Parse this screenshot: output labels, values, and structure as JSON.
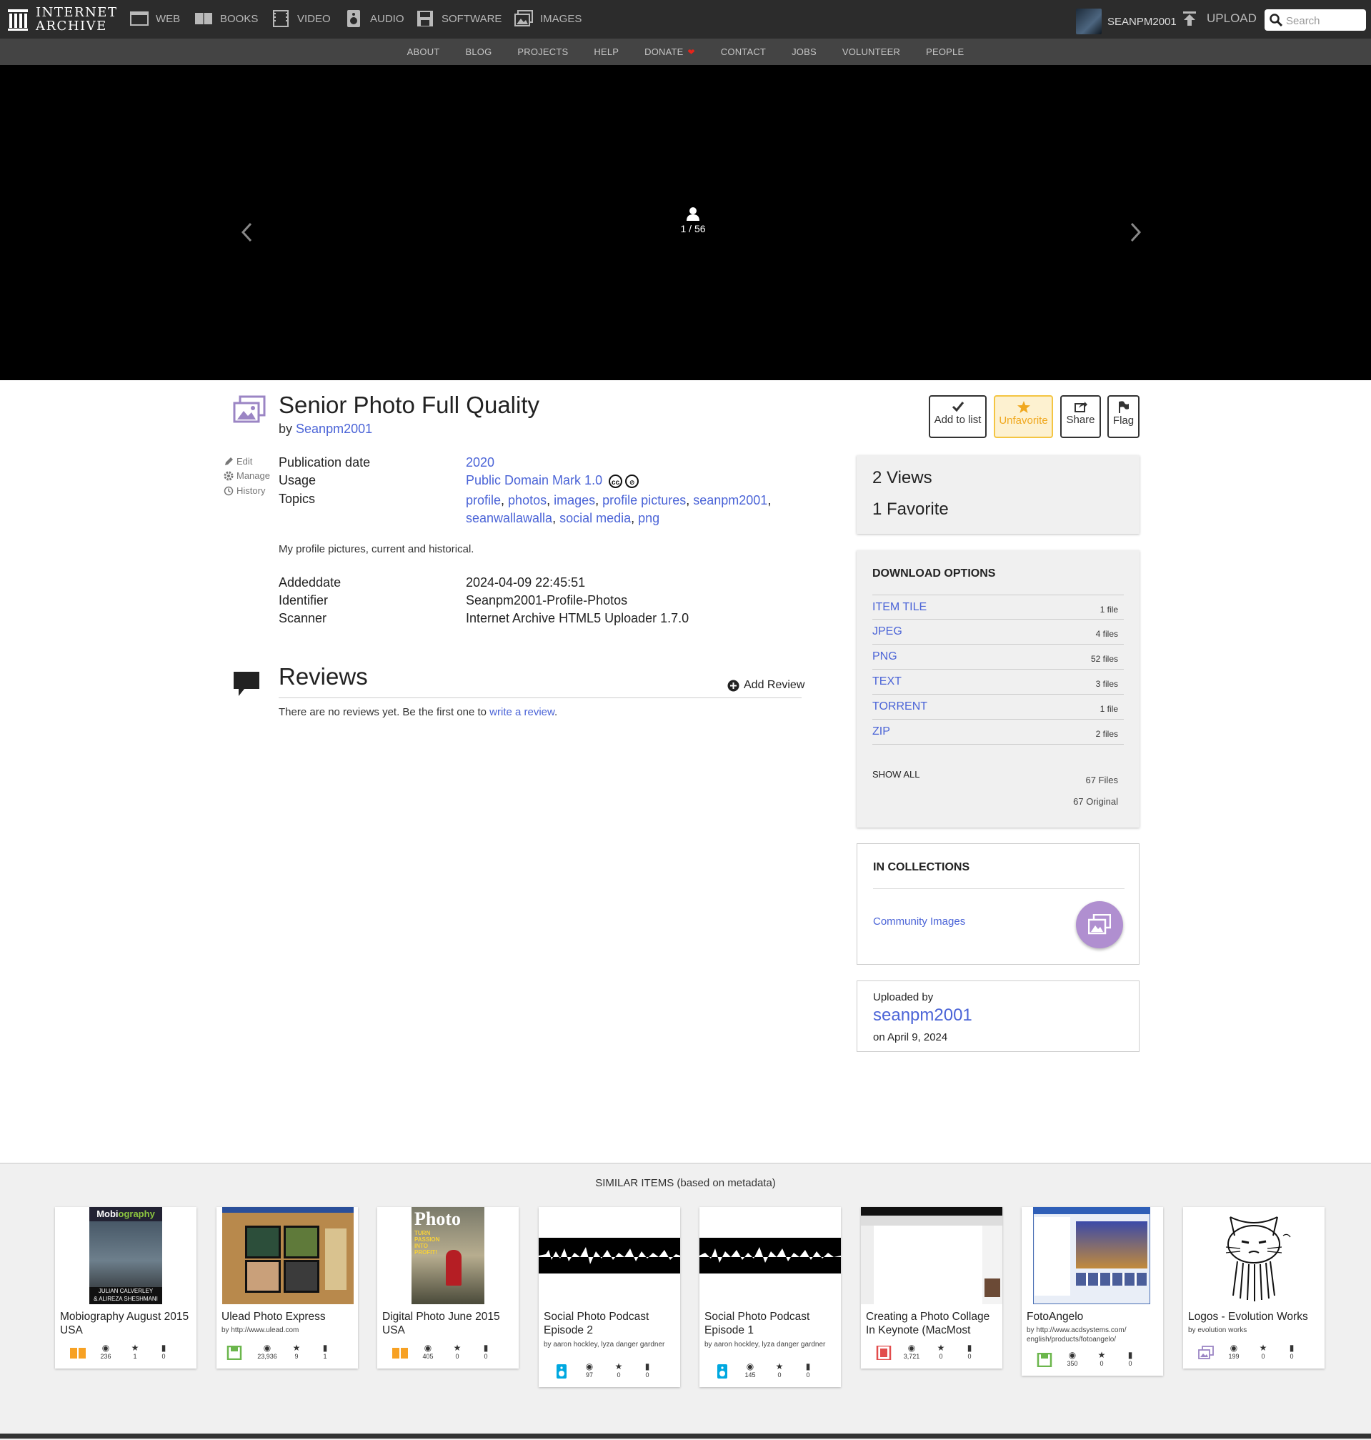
{
  "header": {
    "logo_line1": "INTERNET",
    "logo_line2": "ARCHIVE",
    "nav": [
      {
        "label": "WEB",
        "icon": "web-icon"
      },
      {
        "label": "BOOKS",
        "icon": "books-icon"
      },
      {
        "label": "VIDEO",
        "icon": "video-icon"
      },
      {
        "label": "AUDIO",
        "icon": "audio-icon"
      },
      {
        "label": "SOFTWARE",
        "icon": "software-icon"
      },
      {
        "label": "IMAGES",
        "icon": "images-icon"
      }
    ],
    "username": "SEANPM2001",
    "upload_label": "UPLOAD",
    "search_placeholder": "Search"
  },
  "subnav": [
    "ABOUT",
    "BLOG",
    "PROJECTS",
    "HELP",
    "DONATE",
    "CONTACT",
    "JOBS",
    "VOLUNTEER",
    "PEOPLE"
  ],
  "viewer": {
    "page_indicator": "1 / 56"
  },
  "item": {
    "title": "Senior Photo Full Quality",
    "by_prefix": "by",
    "creator": "Seanpm2001",
    "actions": {
      "add_to_list": "Add to list",
      "unfavorite": "Unfavorite",
      "share": "Share",
      "flag": "Flag"
    },
    "side_links": {
      "edit": "Edit",
      "manage": "Manage",
      "history": "History"
    },
    "metadata": {
      "publication_date_label": "Publication date",
      "publication_date": "2020",
      "usage_label": "Usage",
      "usage": "Public Domain Mark 1.0",
      "topics_label": "Topics",
      "topics": [
        "profile",
        "photos",
        "images",
        "profile pictures",
        "seanpm2001",
        "seanwallawalla",
        "social media",
        "png"
      ]
    },
    "description": "My profile pictures, current and historical.",
    "details": {
      "addeddate_label": "Addeddate",
      "addeddate": "2024-04-09 22:45:51",
      "identifier_label": "Identifier",
      "identifier": "Seanpm2001-Profile-Photos",
      "scanner_label": "Scanner",
      "scanner": "Internet Archive HTML5 Uploader 1.7.0"
    }
  },
  "reviews": {
    "title": "Reviews",
    "add_label": "Add Review",
    "empty_text": "There are no reviews yet. Be the first one to",
    "empty_link": "write a review"
  },
  "stats": {
    "views": "2 Views",
    "favorites": "1 Favorite"
  },
  "downloads": {
    "title": "DOWNLOAD OPTIONS",
    "rows": [
      {
        "name": "ITEM TILE",
        "count": "1 file"
      },
      {
        "name": "JPEG",
        "count": "4 files"
      },
      {
        "name": "PNG",
        "count": "52 files"
      },
      {
        "name": "TEXT",
        "count": "3 files"
      },
      {
        "name": "TORRENT",
        "count": "1 file"
      },
      {
        "name": "ZIP",
        "count": "2 files"
      }
    ],
    "show_all": "SHOW ALL",
    "total_files": "67 Files",
    "total_original": "67 Original"
  },
  "collections": {
    "title": "IN COLLECTIONS",
    "items": [
      "Community Images"
    ]
  },
  "uploader": {
    "label": "Uploaded by",
    "name": "seanpm2001",
    "date": "on April 9, 2024"
  },
  "similar": {
    "title": "SIMILAR ITEMS (based on metadata)",
    "items": [
      {
        "title": "Mobiography August 2015 USA",
        "by": "",
        "type": "texts-icon",
        "views": "236",
        "favs": "1",
        "reviews": "0"
      },
      {
        "title": "Ulead Photo Express",
        "by": "by http://www.ulead.com",
        "type": "software-icon",
        "views": "23,936",
        "favs": "9",
        "reviews": "1"
      },
      {
        "title": "Digital Photo June 2015 USA",
        "by": "",
        "type": "texts-icon",
        "views": "405",
        "favs": "0",
        "reviews": "0"
      },
      {
        "title": "Social Photo Podcast Episode 2",
        "by": "by aaron hockley, lyza danger gardner",
        "type": "audio-icon",
        "views": "97",
        "favs": "0",
        "reviews": "0"
      },
      {
        "title": "Social Photo Podcast Episode 1",
        "by": "by aaron hockley, lyza danger gardner",
        "type": "audio-icon",
        "views": "145",
        "favs": "0",
        "reviews": "0"
      },
      {
        "title": "Creating a Photo Collage In Keynote (MacMost",
        "by": "",
        "type": "video-icon",
        "views": "3,721",
        "favs": "0",
        "reviews": "0"
      },
      {
        "title": "FotoAngelo",
        "by": "by http://www.acdsystems.com/ english/products/fotoangelo/",
        "type": "software-icon",
        "views": "350",
        "favs": "0",
        "reviews": "0"
      },
      {
        "title": "Logos - Evolution Works",
        "by": "by evolution works",
        "type": "image-icon",
        "views": "199",
        "favs": "0",
        "reviews": "0"
      }
    ]
  },
  "colors": {
    "link": "#4b64d7",
    "topbar": "#2c2c2c",
    "subnav": "#444444",
    "favorite": "#f4c542",
    "collection_circle": "#b08fd0",
    "texts_type": "#f7a123",
    "software_type": "#6bb64c",
    "audio_type": "#00a8e0",
    "video_type": "#e24c4c",
    "image_type": "#9b85c4"
  }
}
